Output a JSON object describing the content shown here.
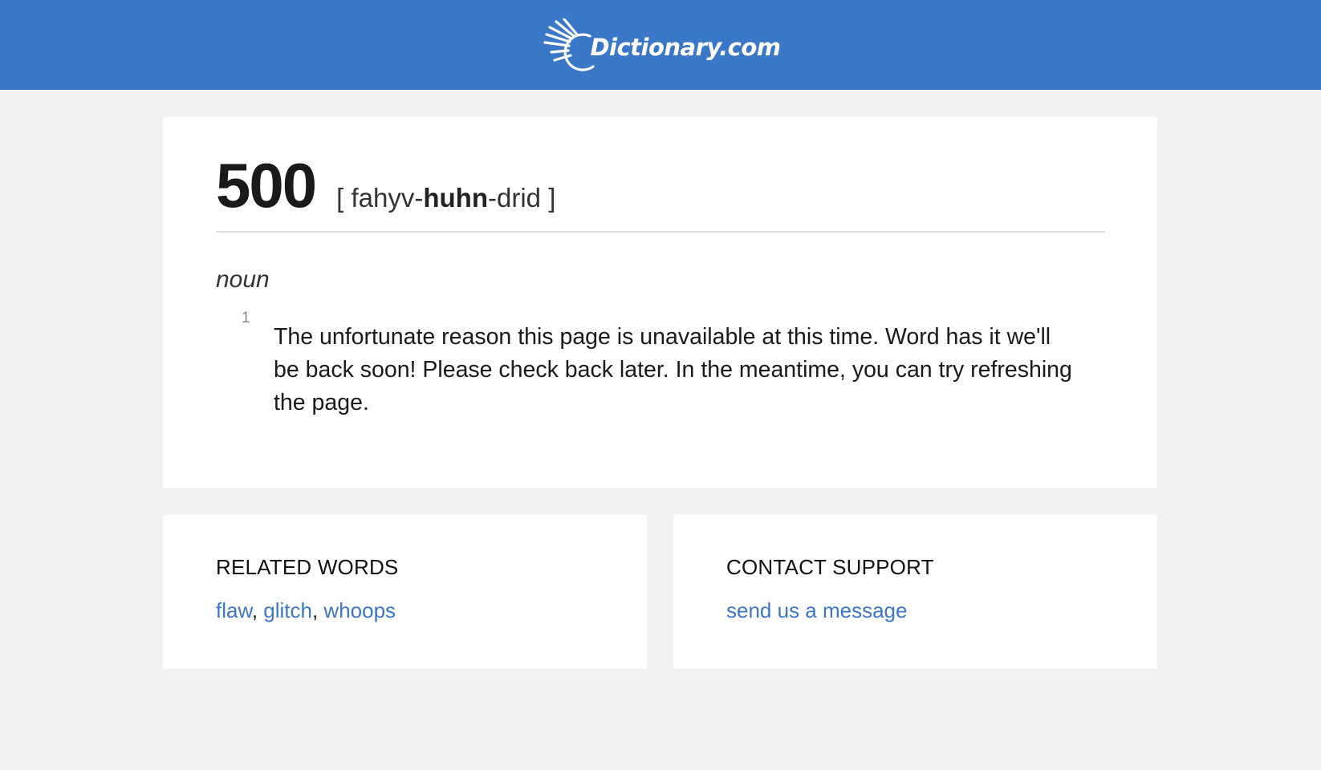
{
  "header": {
    "logo_text": "Dictionary.com",
    "bg_color": "#3b77c7"
  },
  "entry": {
    "headword": "500",
    "pronunciation": {
      "open": "[ ",
      "pre": "fahyv-",
      "stress": "huhn",
      "post": "-drid",
      "close": " ]"
    },
    "part_of_speech": "noun",
    "sense_number": "1",
    "definition": "The unfortunate reason this page is unavailable at this time. Word has it we'll be back soon! Please check back later. In the meantime, you can try refreshing the page."
  },
  "related": {
    "title": "RELATED WORDS",
    "words": [
      "flaw",
      "glitch",
      "whoops"
    ],
    "separator": ", "
  },
  "contact": {
    "title": "CONTACT SUPPORT",
    "link_label": "send us a message"
  },
  "colors": {
    "link": "#3b77c7",
    "page_bg": "#f2f2f2"
  }
}
